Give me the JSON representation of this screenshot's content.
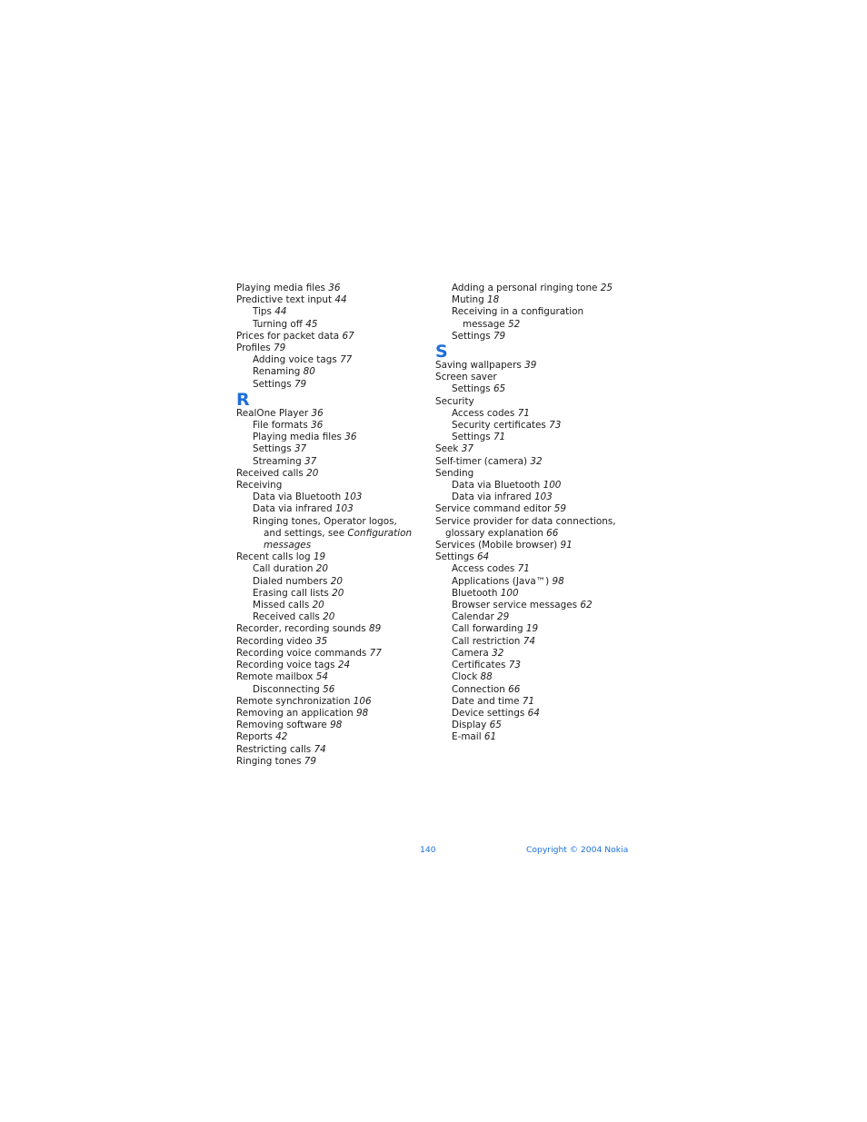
{
  "left_column": [
    {
      "type": "entry",
      "level": 0,
      "text": "Playing media files",
      "page": "36"
    },
    {
      "type": "entry",
      "level": 0,
      "text": "Predictive text input",
      "page": "44"
    },
    {
      "type": "entry",
      "level": 1,
      "text": "Tips",
      "page": "44"
    },
    {
      "type": "entry",
      "level": 1,
      "text": "Turning off",
      "page": "45"
    },
    {
      "type": "entry",
      "level": 0,
      "text": "Prices for packet data",
      "page": "67"
    },
    {
      "type": "entry",
      "level": 0,
      "text": "Profiles",
      "page": "79"
    },
    {
      "type": "entry",
      "level": 1,
      "text": "Adding voice tags",
      "page": "77"
    },
    {
      "type": "entry",
      "level": 1,
      "text": "Renaming",
      "page": "80"
    },
    {
      "type": "entry",
      "level": 1,
      "text": "Settings",
      "page": "79"
    },
    {
      "type": "letter",
      "text": "R"
    },
    {
      "type": "entry",
      "level": 0,
      "text": "RealOne Player",
      "page": "36"
    },
    {
      "type": "entry",
      "level": 1,
      "text": "File formats",
      "page": "36"
    },
    {
      "type": "entry",
      "level": 1,
      "text": "Playing media files",
      "page": "36"
    },
    {
      "type": "entry",
      "level": 1,
      "text": "Settings",
      "page": "37"
    },
    {
      "type": "entry",
      "level": 1,
      "text": "Streaming",
      "page": "37"
    },
    {
      "type": "entry",
      "level": 0,
      "text": "Received calls",
      "page": "20"
    },
    {
      "type": "entry",
      "level": 0,
      "text": "Receiving",
      "page": ""
    },
    {
      "type": "entry",
      "level": 1,
      "text": "Data via Bluetooth",
      "page": "103"
    },
    {
      "type": "entry",
      "level": 1,
      "text": "Data via infrared",
      "page": "103"
    },
    {
      "type": "entry",
      "level": 1,
      "text": "Ringing tones, Operator logos,",
      "page": ""
    },
    {
      "type": "cont",
      "level": 1,
      "text": "and settings, see",
      "ref": "Configuration"
    },
    {
      "type": "cont",
      "level": 1,
      "text": "",
      "ref": "messages"
    },
    {
      "type": "entry",
      "level": 0,
      "text": "Recent calls log",
      "page": "19"
    },
    {
      "type": "entry",
      "level": 1,
      "text": "Call duration",
      "page": "20"
    },
    {
      "type": "entry",
      "level": 1,
      "text": "Dialed numbers",
      "page": "20"
    },
    {
      "type": "entry",
      "level": 1,
      "text": "Erasing call lists",
      "page": "20"
    },
    {
      "type": "entry",
      "level": 1,
      "text": "Missed calls",
      "page": "20"
    },
    {
      "type": "entry",
      "level": 1,
      "text": "Received calls",
      "page": "20"
    },
    {
      "type": "entry",
      "level": 0,
      "text": "Recorder, recording sounds",
      "page": "89"
    },
    {
      "type": "entry",
      "level": 0,
      "text": "Recording video",
      "page": "35"
    },
    {
      "type": "entry",
      "level": 0,
      "text": "Recording voice commands",
      "page": "77"
    },
    {
      "type": "entry",
      "level": 0,
      "text": "Recording voice tags",
      "page": "24"
    },
    {
      "type": "entry",
      "level": 0,
      "text": "Remote mailbox",
      "page": "54"
    },
    {
      "type": "entry",
      "level": 1,
      "text": "Disconnecting",
      "page": "56"
    },
    {
      "type": "entry",
      "level": 0,
      "text": "Remote synchronization",
      "page": "106"
    },
    {
      "type": "entry",
      "level": 0,
      "text": "Removing an application",
      "page": "98"
    },
    {
      "type": "entry",
      "level": 0,
      "text": "Removing software",
      "page": "98"
    },
    {
      "type": "entry",
      "level": 0,
      "text": "Reports",
      "page": "42"
    },
    {
      "type": "entry",
      "level": 0,
      "text": "Restricting calls",
      "page": "74"
    },
    {
      "type": "entry",
      "level": 0,
      "text": "Ringing tones",
      "page": "79"
    }
  ],
  "right_column": [
    {
      "type": "entry",
      "level": 1,
      "text": "Adding a personal ringing tone",
      "page": "25"
    },
    {
      "type": "entry",
      "level": 1,
      "text": "Muting",
      "page": "18"
    },
    {
      "type": "entry",
      "level": 1,
      "text": "Receiving in a configuration",
      "page": ""
    },
    {
      "type": "cont",
      "level": 1,
      "text": "message",
      "page": "52"
    },
    {
      "type": "entry",
      "level": 1,
      "text": "Settings",
      "page": "79"
    },
    {
      "type": "letter",
      "text": "S"
    },
    {
      "type": "entry",
      "level": 0,
      "text": "Saving wallpapers",
      "page": "39"
    },
    {
      "type": "entry",
      "level": 0,
      "text": "Screen saver",
      "page": ""
    },
    {
      "type": "entry",
      "level": 1,
      "text": "Settings",
      "page": "65"
    },
    {
      "type": "entry",
      "level": 0,
      "text": "Security",
      "page": ""
    },
    {
      "type": "entry",
      "level": 1,
      "text": "Access codes",
      "page": "71"
    },
    {
      "type": "entry",
      "level": 1,
      "text": "Security certificates",
      "page": "73"
    },
    {
      "type": "entry",
      "level": 1,
      "text": "Settings",
      "page": "71"
    },
    {
      "type": "entry",
      "level": 0,
      "text": "Seek",
      "page": "37"
    },
    {
      "type": "entry",
      "level": 0,
      "text": "Self-timer (camera)",
      "page": "32"
    },
    {
      "type": "entry",
      "level": 0,
      "text": "Sending",
      "page": ""
    },
    {
      "type": "entry",
      "level": 1,
      "text": "Data via Bluetooth",
      "page": "100"
    },
    {
      "type": "entry",
      "level": 1,
      "text": "Data via infrared",
      "page": "103"
    },
    {
      "type": "entry",
      "level": 0,
      "text": "Service command editor",
      "page": "59"
    },
    {
      "type": "entry",
      "level": 0,
      "text": "Service provider for data connections,",
      "page": ""
    },
    {
      "type": "cont",
      "level": 0,
      "text": "glossary explanation",
      "page": "66"
    },
    {
      "type": "entry",
      "level": 0,
      "text": "Services (Mobile browser)",
      "page": "91"
    },
    {
      "type": "entry",
      "level": 0,
      "text": "Settings",
      "page": "64"
    },
    {
      "type": "entry",
      "level": 1,
      "text": "Access codes",
      "page": "71"
    },
    {
      "type": "entry",
      "level": 1,
      "text": "Applications (Java™)",
      "page": "98"
    },
    {
      "type": "entry",
      "level": 1,
      "text": "Bluetooth",
      "page": "100"
    },
    {
      "type": "entry",
      "level": 1,
      "text": "Browser service messages",
      "page": "62"
    },
    {
      "type": "entry",
      "level": 1,
      "text": "Calendar",
      "page": "29"
    },
    {
      "type": "entry",
      "level": 1,
      "text": "Call forwarding",
      "page": "19"
    },
    {
      "type": "entry",
      "level": 1,
      "text": "Call restriction",
      "page": "74"
    },
    {
      "type": "entry",
      "level": 1,
      "text": "Camera",
      "page": "32"
    },
    {
      "type": "entry",
      "level": 1,
      "text": "Certificates",
      "page": "73"
    },
    {
      "type": "entry",
      "level": 1,
      "text": "Clock",
      "page": "88"
    },
    {
      "type": "entry",
      "level": 1,
      "text": "Connection",
      "page": "66"
    },
    {
      "type": "entry",
      "level": 1,
      "text": "Date and time",
      "page": "71"
    },
    {
      "type": "entry",
      "level": 1,
      "text": "Device settings",
      "page": "64"
    },
    {
      "type": "entry",
      "level": 1,
      "text": "Display",
      "page": "65"
    },
    {
      "type": "entry",
      "level": 1,
      "text": "E-mail",
      "page": "61"
    }
  ],
  "footer": {
    "page_number": "140",
    "copyright": "Copyright © 2004 Nokia"
  },
  "colors": {
    "accent": "#1e6fd9",
    "text": "#1a1a1a"
  }
}
